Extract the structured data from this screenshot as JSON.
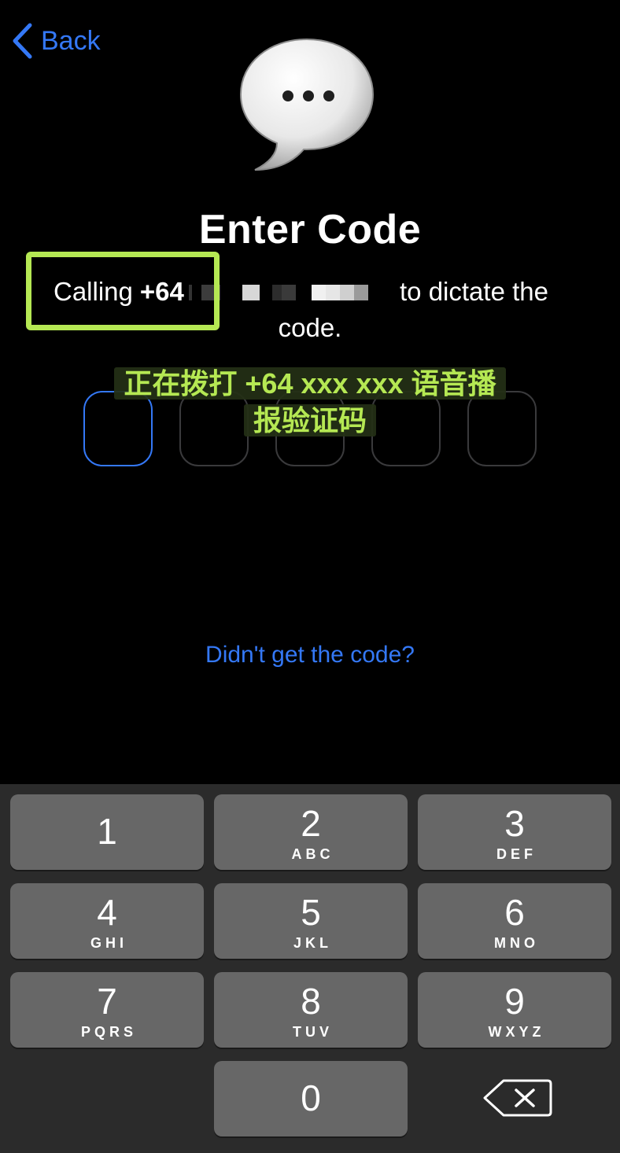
{
  "nav": {
    "back_label": "Back"
  },
  "header": {
    "title": "Enter Code"
  },
  "message": {
    "prefix": "Calling",
    "country_code": "+64",
    "suffix": "to dictate the",
    "line2": "code."
  },
  "annotation": {
    "line1": "正在拨打 +64 xxx xxx 语音播",
    "line2": "报验证码",
    "color": "#b5e853"
  },
  "code_boxes": {
    "count": 5,
    "active_index": 0
  },
  "help_link": "Didn't get the code?",
  "keypad": {
    "keys": [
      {
        "digit": "1",
        "letters": ""
      },
      {
        "digit": "2",
        "letters": "ABC"
      },
      {
        "digit": "3",
        "letters": "DEF"
      },
      {
        "digit": "4",
        "letters": "GHI"
      },
      {
        "digit": "5",
        "letters": "JKL"
      },
      {
        "digit": "6",
        "letters": "MNO"
      },
      {
        "digit": "7",
        "letters": "PQRS"
      },
      {
        "digit": "8",
        "letters": "TUV"
      },
      {
        "digit": "9",
        "letters": "WXYZ"
      },
      {
        "digit": "0",
        "letters": ""
      }
    ],
    "delete_icon": "backspace-icon"
  },
  "colors": {
    "accent": "#3478f6",
    "key_bg": "#676767",
    "keyboard_bg": "#2b2b2b"
  }
}
